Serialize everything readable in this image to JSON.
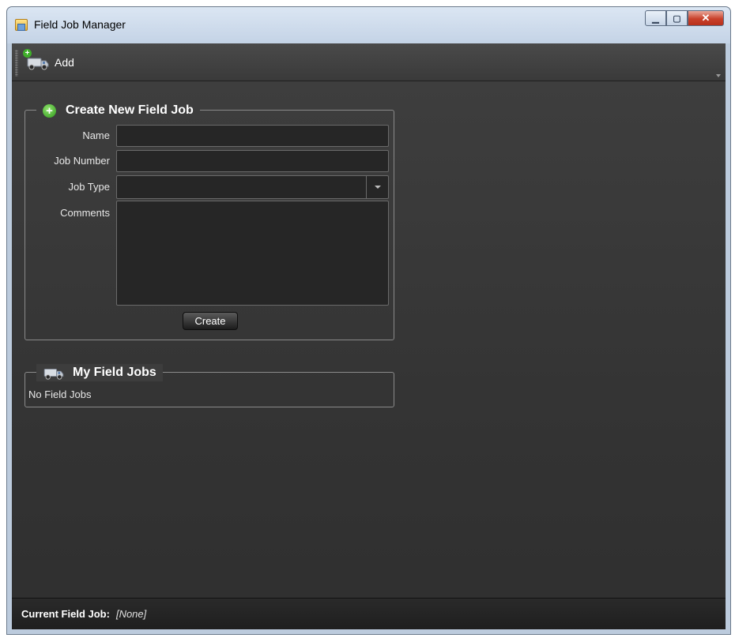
{
  "window": {
    "title": "Field Job Manager"
  },
  "toolbar": {
    "add_label": "Add"
  },
  "create_section": {
    "title": "Create New Field Job",
    "fields": {
      "name_label": "Name",
      "name_value": "",
      "job_number_label": "Job Number",
      "job_number_value": "",
      "job_type_label": "Job Type",
      "job_type_value": "",
      "comments_label": "Comments",
      "comments_value": ""
    },
    "create_button": "Create"
  },
  "my_jobs_section": {
    "title": "My Field Jobs",
    "empty_text": "No Field Jobs"
  },
  "status_bar": {
    "label": "Current Field Job:",
    "value": "[None]"
  },
  "icons": [
    "app-icon",
    "truck-icon",
    "plus-icon",
    "dropdown-arrow-icon"
  ],
  "colors": {
    "background": "#3a3a3a",
    "text": "#ffffff",
    "accent_green": "#3fae2a"
  }
}
